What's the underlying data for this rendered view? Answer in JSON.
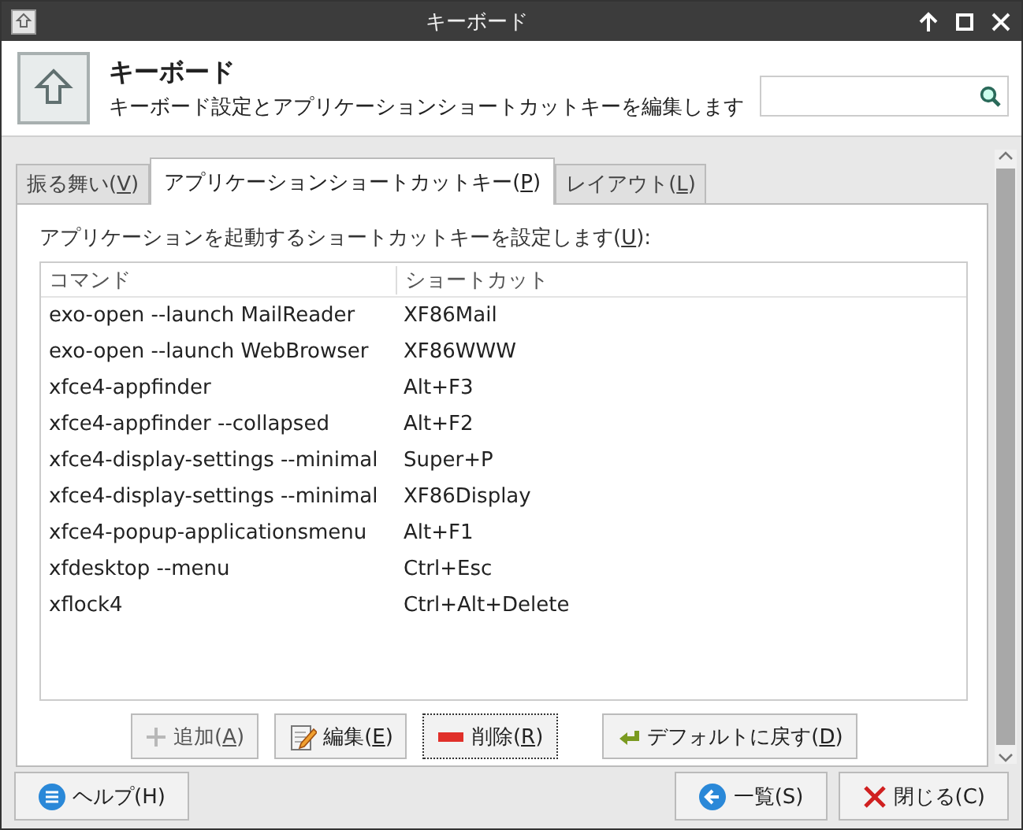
{
  "window": {
    "title": "キーボード"
  },
  "header": {
    "title": "キーボード",
    "subtitle": "キーボード設定とアプリケーションショートカットキーを編集します"
  },
  "tabs": [
    {
      "label": "振る舞い(V)",
      "selected": false
    },
    {
      "label": "アプリケーションショートカットキー(P)",
      "selected": true
    },
    {
      "label": "レイアウト(L)",
      "selected": false
    }
  ],
  "panel": {
    "label": "アプリケーションを起動するショートカットキーを設定します(U):",
    "table": {
      "columns": [
        "コマンド",
        "ショートカット"
      ],
      "rows": [
        [
          "exo-open --launch MailReader",
          "XF86Mail"
        ],
        [
          "exo-open --launch WebBrowser",
          "XF86WWW"
        ],
        [
          "xfce4-appfinder",
          "Alt+F3"
        ],
        [
          "xfce4-appfinder --collapsed",
          "Alt+F2"
        ],
        [
          "xfce4-display-settings --minimal",
          "Super+P"
        ],
        [
          "xfce4-display-settings --minimal",
          "XF86Display"
        ],
        [
          "xfce4-popup-applicationsmenu",
          "Alt+F1"
        ],
        [
          "xfdesktop --menu",
          "Ctrl+Esc"
        ],
        [
          "xflock4",
          "Ctrl+Alt+Delete"
        ]
      ]
    },
    "buttons": [
      {
        "kind": "add",
        "label": "追加(A)",
        "disabled": true
      },
      {
        "kind": "edit",
        "label": "編集(E)",
        "disabled": false
      },
      {
        "kind": "remove",
        "label": "削除(R)",
        "disabled": false
      },
      {
        "kind": "reset",
        "label": "デフォルトに戻す(D)",
        "disabled": false
      }
    ]
  },
  "footer": {
    "left": [
      {
        "kind": "help",
        "label": "ヘルプ(H)"
      }
    ],
    "right": [
      {
        "kind": "back",
        "label": "一覧(S)"
      },
      {
        "kind": "close",
        "label": "閉じる(C)"
      }
    ]
  }
}
